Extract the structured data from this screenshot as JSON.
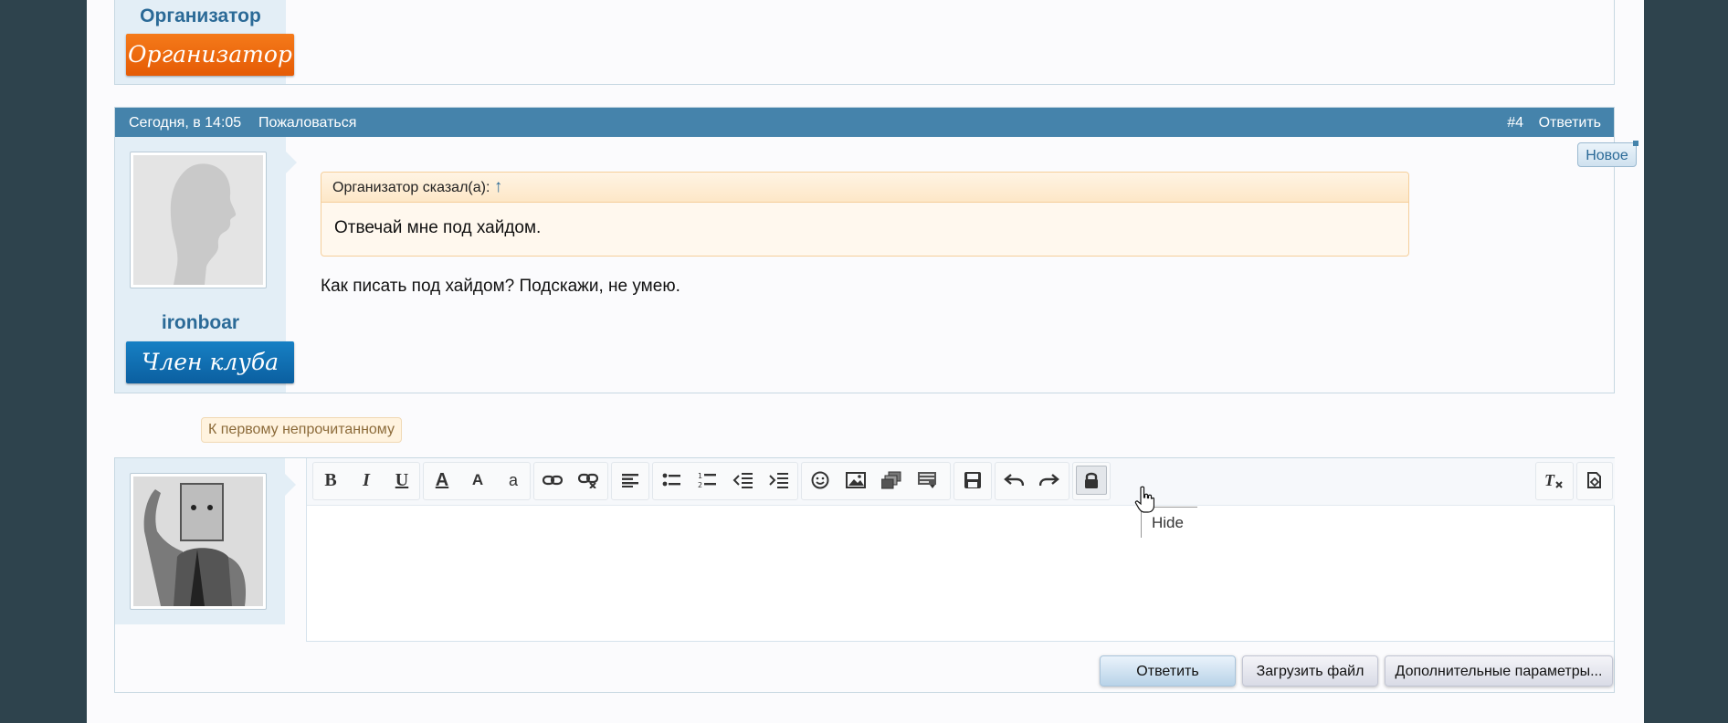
{
  "prev_post": {
    "username": "Организатор",
    "title_badge": "Организатор"
  },
  "post": {
    "date": "Сегодня, в 14:05",
    "report_label": "Пожаловаться",
    "number": "#4",
    "reply_label": "Ответить",
    "new_badge": "Новое",
    "username": "ironboar",
    "title_badge": "Член клуба",
    "quote": {
      "author_line": "Организатор сказал(а):",
      "arrow": "↑",
      "text": "Отвечай мне под хайдом."
    },
    "message": "Как писать под хайдом? Подскажи, не умею."
  },
  "unread_link": "К первому непрочитанному",
  "editor": {
    "toolbar": [
      {
        "icon": "bold-icon",
        "glyph": "B"
      },
      {
        "icon": "italic-icon",
        "glyph": "I"
      },
      {
        "icon": "underline-icon",
        "glyph": "U"
      },
      {
        "icon": "font-color-icon",
        "glyph": "A"
      },
      {
        "icon": "font-size-icon",
        "glyph": "A"
      },
      {
        "icon": "font-family-icon",
        "glyph": "a"
      },
      {
        "icon": "link-icon"
      },
      {
        "icon": "unlink-icon"
      },
      {
        "icon": "align-icon"
      },
      {
        "icon": "bulleted-list-icon"
      },
      {
        "icon": "numbered-list-icon"
      },
      {
        "icon": "outdent-icon"
      },
      {
        "icon": "indent-icon"
      },
      {
        "icon": "smilie-icon"
      },
      {
        "icon": "image-icon"
      },
      {
        "icon": "media-icon"
      },
      {
        "icon": "insert-more-icon"
      },
      {
        "icon": "save-draft-icon"
      },
      {
        "icon": "undo-icon"
      },
      {
        "icon": "redo-icon"
      },
      {
        "icon": "hide-lock-icon",
        "active": true
      },
      {
        "icon": "remove-format-icon"
      },
      {
        "icon": "toggle-bbcode-icon"
      }
    ],
    "tooltip": "Hide",
    "content": ""
  },
  "buttons": {
    "reply": "Ответить",
    "upload": "Загрузить файл",
    "more_options": "Дополнительные параметры..."
  },
  "colors": {
    "accent": "#4583ab",
    "background": "#2e434d",
    "username": "#2b6a97",
    "organizer_badge": "#e55b05",
    "member_badge": "#0b5fa0"
  }
}
